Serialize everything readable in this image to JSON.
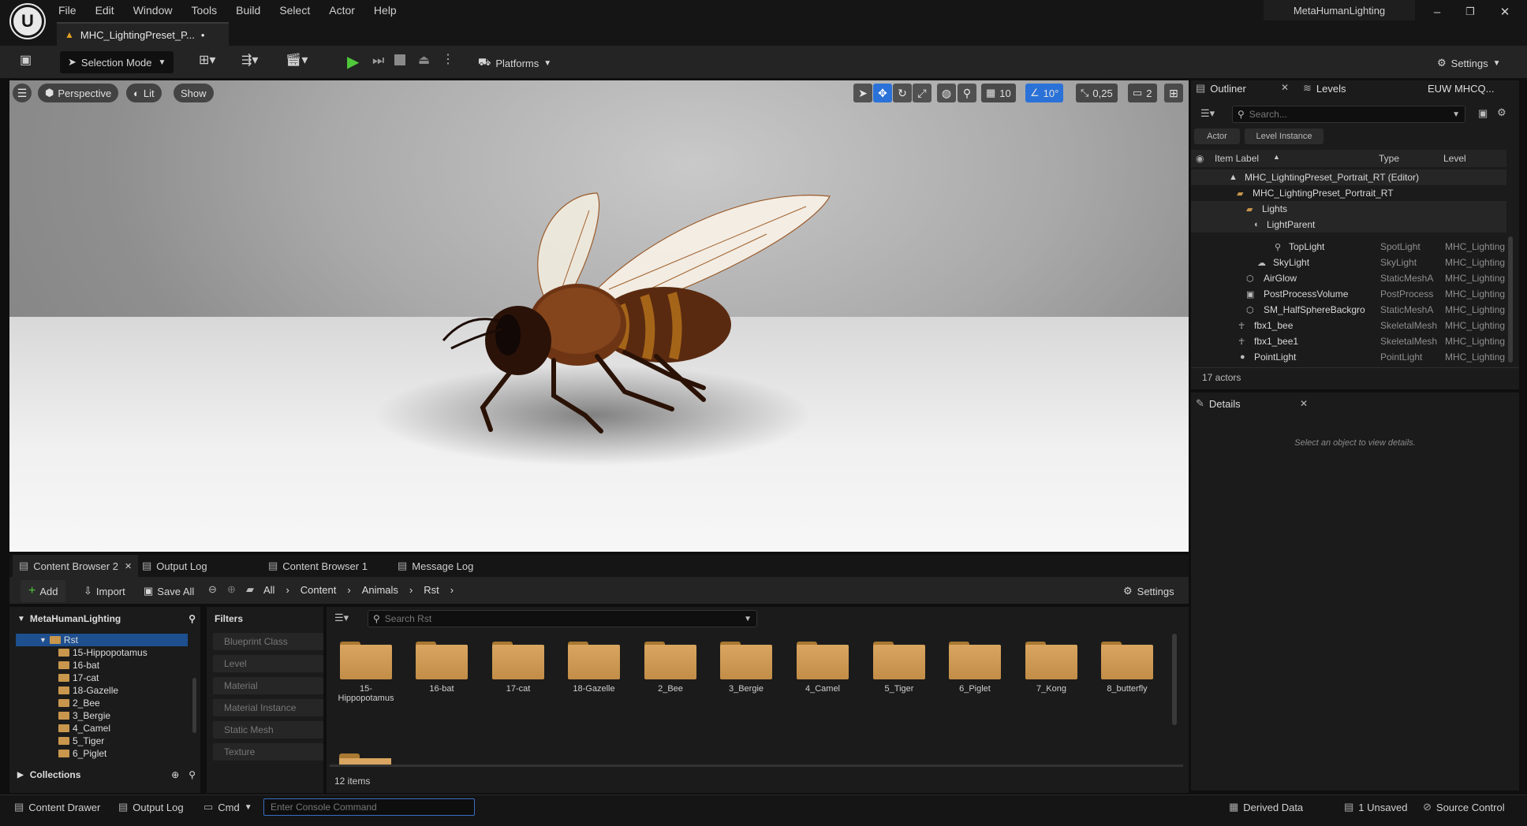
{
  "app": {
    "project_name": "MetaHumanLighting",
    "document_tab": "MHC_LightingPreset_P...",
    "document_tab_modified": "•"
  },
  "menu": [
    "File",
    "Edit",
    "Window",
    "Tools",
    "Build",
    "Select",
    "Actor",
    "Help"
  ],
  "toolbar": {
    "selection_mode": "Selection Mode",
    "platforms": "Platforms",
    "settings": "Settings"
  },
  "viewport": {
    "perspective": "Perspective",
    "lit": "Lit",
    "show": "Show",
    "grid_snap": "10",
    "rotation_snap": "10°",
    "scale_snap": "0,25",
    "camera_speed": "2"
  },
  "outliner": {
    "tab_outliner": "Outliner",
    "tab_levels": "Levels",
    "tab_extra": "EUW MHCQ...",
    "search_placeholder": "Search...",
    "filter_actor": "Actor",
    "filter_level_instance": "Level Instance",
    "col_label": "Item Label",
    "col_type": "Type",
    "col_level": "Level",
    "rows": [
      {
        "label": "MHC_LightingPreset_Portrait_RT (Editor)",
        "type": "",
        "level": ""
      },
      {
        "label": "MHC_LightingPreset_Portrait_RT",
        "type": "",
        "level": ""
      },
      {
        "label": "Lights",
        "type": "",
        "level": ""
      },
      {
        "label": "LightParent",
        "type": "",
        "level": ""
      },
      {
        "label": "TopLight",
        "type": "SpotLight",
        "level": "MHC_Lighting"
      },
      {
        "label": "SkyLight",
        "type": "SkyLight",
        "level": "MHC_Lighting"
      },
      {
        "label": "AirGlow",
        "type": "StaticMeshA",
        "level": "MHC_Lighting"
      },
      {
        "label": "PostProcessVolume",
        "type": "PostProcess",
        "level": "MHC_Lighting"
      },
      {
        "label": "SM_HalfSphereBackgro",
        "type": "StaticMeshA",
        "level": "MHC_Lighting"
      },
      {
        "label": "fbx1_bee",
        "type": "SkeletalMesh",
        "level": "MHC_Lighting"
      },
      {
        "label": "fbx1_bee1",
        "type": "SkeletalMesh",
        "level": "MHC_Lighting"
      },
      {
        "label": "PointLight",
        "type": "PointLight",
        "level": "MHC_Lighting"
      }
    ],
    "actor_count": "17 actors"
  },
  "details": {
    "tab": "Details",
    "empty_message": "Select an object to view details."
  },
  "content_browser": {
    "tabs": [
      "Content Browser 2",
      "Output Log",
      "Content Browser 1",
      "Message Log"
    ],
    "add": "Add",
    "import": "Import",
    "save_all": "Save All",
    "breadcrumb": [
      "All",
      "Content",
      "Animals",
      "Rst"
    ],
    "settings": "Settings",
    "tree_root": "MetaHumanLighting",
    "tree_items": [
      "Rst",
      "15-Hippopotamus",
      "16-bat",
      "17-cat",
      "18-Gazelle",
      "2_Bee",
      "3_Bergie",
      "4_Camel",
      "5_Tiger",
      "6_Piglet"
    ],
    "collections": "Collections",
    "filters_title": "Filters",
    "filters": [
      "Blueprint Class",
      "Level",
      "Material",
      "Material Instance",
      "Static Mesh",
      "Texture"
    ],
    "search_placeholder": "Search Rst",
    "assets": [
      "15-Hippopotamus",
      "16-bat",
      "17-cat",
      "18-Gazelle",
      "2_Bee",
      "3_Bergie",
      "4_Camel",
      "5_Tiger",
      "6_Piglet",
      "7_Kong",
      "8_butterfly"
    ],
    "item_count": "12 items"
  },
  "statusbar": {
    "content_drawer": "Content Drawer",
    "output_log": "Output Log",
    "cmd": "Cmd",
    "console_placeholder": "Enter Console Command",
    "derived_data": "Derived Data",
    "unsaved": "1 Unsaved",
    "source_control": "Source Control"
  }
}
